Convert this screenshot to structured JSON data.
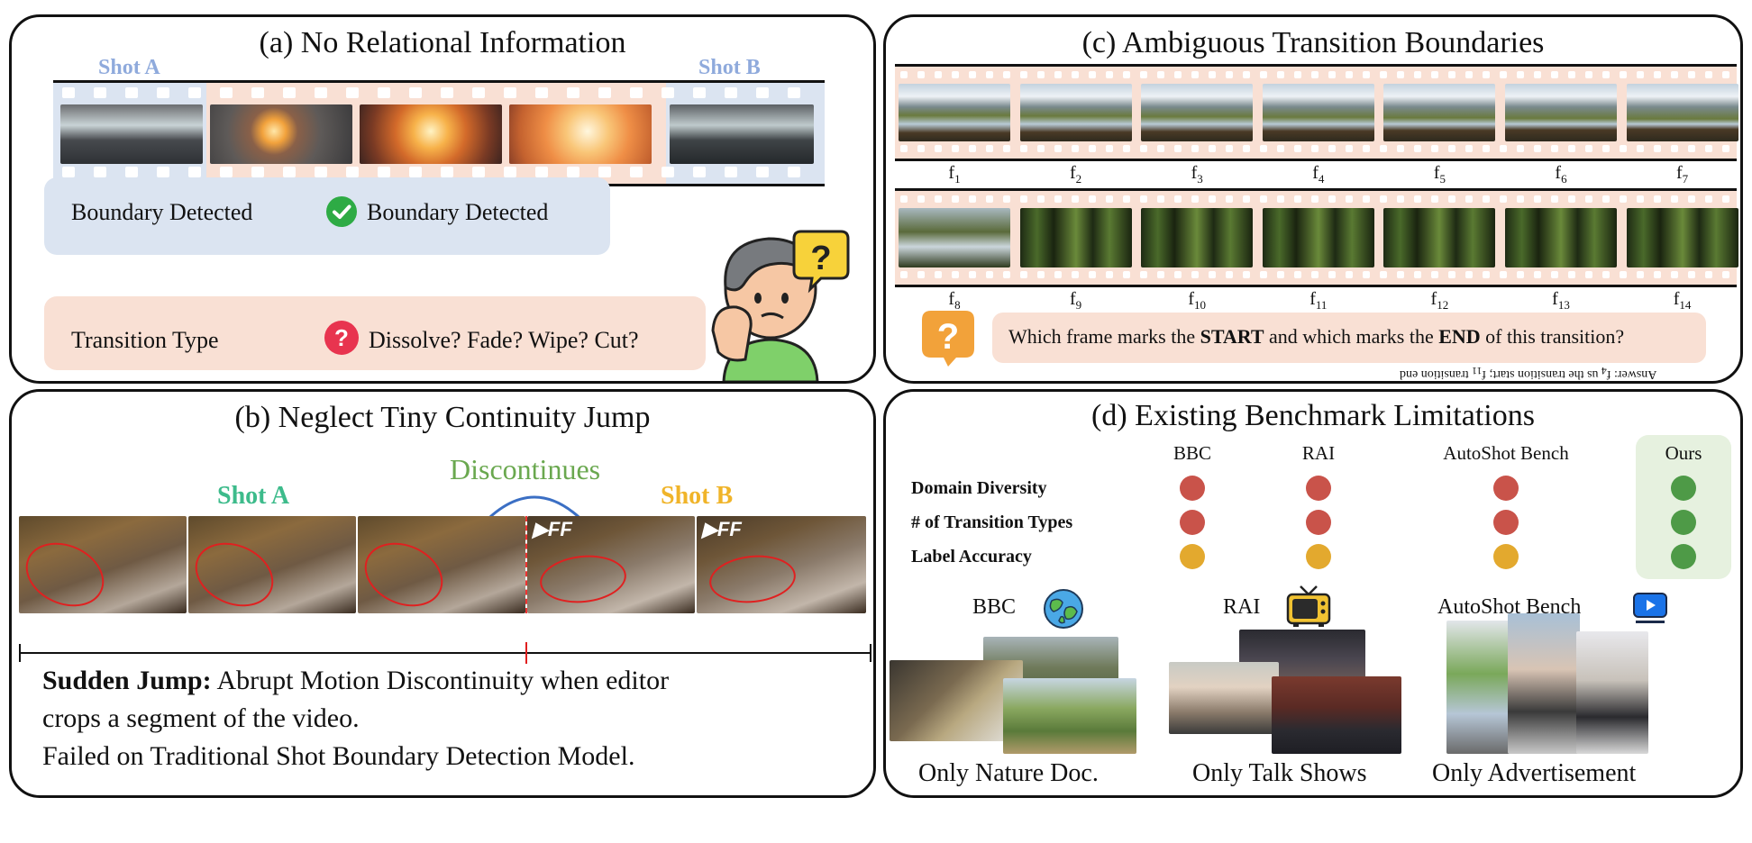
{
  "panel_a": {
    "title": "(a) No Relational Information",
    "shot_a": "Shot A",
    "shot_b": "Shot B",
    "row1_left": "Boundary Detected",
    "row1_right": "Boundary Detected",
    "row2_left": "Transition Type",
    "row2_right": "Dissolve? Fade? Wipe? Cut?",
    "bubble_mark": "?"
  },
  "panel_b": {
    "title": "(b) Neglect Tiny Continuity Jump",
    "shot_a": "Shot A",
    "shot_b": "Shot B",
    "discontinues": "Discontinues",
    "ff_label": "FF",
    "caption_bold": "Sudden Jump:",
    "caption_rest": " Abrupt Motion Discontinuity when editor",
    "caption_line2": "crops a segment of the video.",
    "caption_line3": "Failed on Traditional Shot Boundary Detection Model."
  },
  "panel_c": {
    "title": "(c) Ambiguous Transition Boundaries",
    "frames_row1": [
      "1",
      "2",
      "3",
      "4",
      "5",
      "6",
      "7"
    ],
    "frames_row2": [
      "8",
      "9",
      "10",
      "11",
      "12",
      "13",
      "14"
    ],
    "frame_prefix": "f",
    "question_pre": "Which frame marks the ",
    "question_start": "START",
    "question_mid": " and which marks the ",
    "question_end": "END",
    "question_post": " of this transition?",
    "bubble_mark": "?",
    "answer_pre": "Answer: f",
    "answer_sub1": "4",
    "answer_mid": " us the transition start; f",
    "answer_sub2": "11",
    "answer_post": " transition end"
  },
  "panel_d": {
    "title": "(d) Existing Benchmark Limitations",
    "columns": [
      "BBC",
      "RAI",
      "AutoShot Bench",
      "Ours"
    ],
    "rows": [
      {
        "label": "Domain Diversity",
        "status": [
          "red",
          "red",
          "red",
          "green"
        ]
      },
      {
        "label": "# of Transition Types",
        "status": [
          "red",
          "red",
          "red",
          "green"
        ]
      },
      {
        "label": "Label Accuracy",
        "status": [
          "yellow",
          "yellow",
          "yellow",
          "green"
        ]
      }
    ],
    "datasets": [
      {
        "name": "BBC",
        "caption": "Only Nature Doc."
      },
      {
        "name": "RAI",
        "caption": "Only Talk Shows"
      },
      {
        "name": "AutoShot Bench",
        "caption": "Only Advertisement"
      }
    ]
  },
  "colors": {
    "shot_a_blue": "#dbe4f1",
    "shot_b_peach": "#f9e0d4",
    "shot_label_blue": "#8faadc",
    "shot_a_green": "#3dbb8b",
    "shot_b_gold": "#f0b429",
    "discontinues_green": "#6aa84f",
    "arrow_blue": "#3b6fc4",
    "ours_bg": "#e6f1df",
    "red": "#c9534a",
    "yellow": "#e3a92e",
    "green": "#4e9a47"
  }
}
